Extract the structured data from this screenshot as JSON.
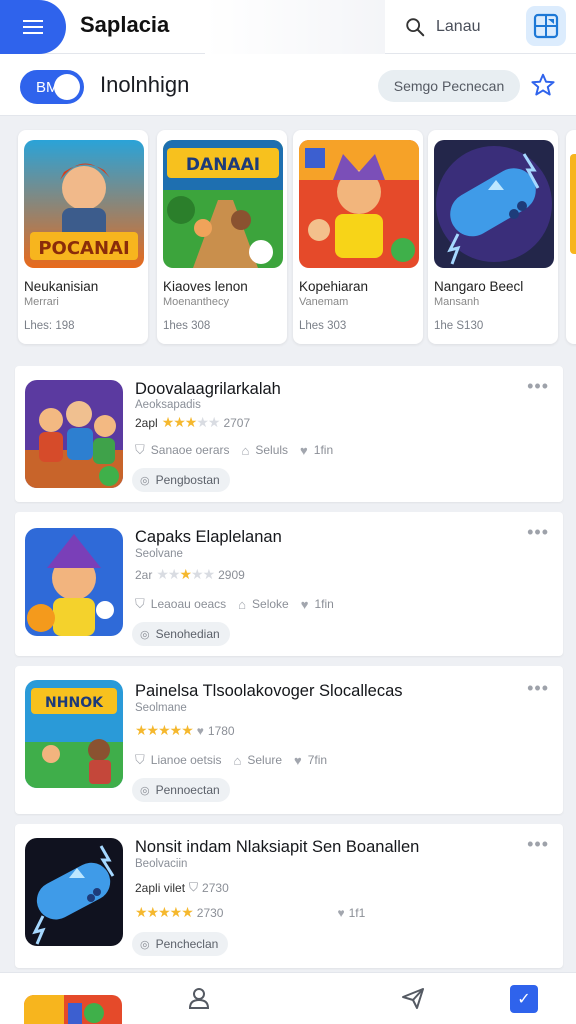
{
  "header": {
    "app_title": "Saplacia",
    "search_label": "Lanau",
    "menu_icon": "hamburger-icon",
    "grid_icon": "grid-icon"
  },
  "subheader": {
    "toggle_label": "BM",
    "title": "Inolnhign",
    "pill_label": "Semgo Pecnecan",
    "star_icon": "star-outline-icon"
  },
  "featured": [
    {
      "name": "Neukanisian",
      "sub": "Merrari",
      "meta": "Lhes: 198",
      "art": "hero-boy-art"
    },
    {
      "name": "Kiaoves lenon",
      "sub": "Moenanthecy",
      "meta": "1hes 308",
      "art": "jungle-adventure-art"
    },
    {
      "name": "Kopehiaran",
      "sub": "Vanemam",
      "meta": "Lhes 303",
      "art": "hero-brawler-art"
    },
    {
      "name": "Nangaro Beecl",
      "sub": "Mansanh",
      "meta": "1he S130",
      "art": "controller-art"
    }
  ],
  "list": [
    {
      "title": "Doovalaagrilarkalah",
      "developer": "Aeoksapadis",
      "rating_text": "2apl",
      "stars": 3,
      "rating_count": "2707",
      "meta_a": "Sanaoe oerars",
      "meta_b": "Seluls",
      "meta_c": "1fin",
      "chip": "Pengbostan",
      "art": "party-heroes-art"
    },
    {
      "title": "Capaks Elaplelanan",
      "developer": "Seolvane",
      "rating_text": "2ar",
      "stars": 3,
      "rating_count": "2909",
      "meta_a": "Leaoau oeacs",
      "meta_b": "Seloke",
      "meta_c": "1fin",
      "chip": "Senohedian",
      "art": "wizard-kid-art"
    },
    {
      "title": "Painelsa Tlsoolakovoger Slocallecas",
      "developer": "Seolmane",
      "rating_text": "",
      "stars": 5,
      "rating_count": "1780",
      "meta_a": "Lianoe oetsis",
      "meta_b": "Selure",
      "meta_c": "7fin",
      "chip": "Pennoectan",
      "art": "island-battle-art"
    },
    {
      "title": "Nonsit indam Nlaksiapit Sen Boanallen",
      "developer": "Beolvaciin",
      "rating_text": "2apli vilet",
      "stars": 5,
      "rating_count": "2730",
      "meta_a": "",
      "meta_b": "",
      "meta_c": "1f1",
      "chip": "Pencheclan",
      "art": "neon-controller-art",
      "extra_rating": "2730"
    }
  ],
  "bottom_nav": {
    "profile_icon": "profile-icon",
    "send_icon": "send-icon",
    "check_icon": "checkbox-icon"
  },
  "colors": {
    "accent": "#2f63ec",
    "star": "#f5b82e",
    "background": "#eef0f4"
  }
}
